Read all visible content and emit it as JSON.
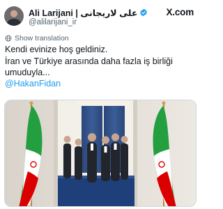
{
  "author": {
    "display_name": "Ali Larijani | علی لاریجانی",
    "handle": "@alilarijani_ir",
    "verified": true
  },
  "brand": {
    "label": "X.com"
  },
  "translation_link": {
    "label": "Show translation",
    "icon": "globe-icon"
  },
  "tweet": {
    "lines": [
      "Kendi evinize hoş geldiniz.",
      "İran ve Türkiye arasında daha fazla iş birliği",
      "umuduyla..."
    ],
    "mention": "@HakanFidan"
  },
  "media": {
    "icons": [
      "iran-flag-left",
      "iran-flag-right"
    ]
  },
  "colors": {
    "link": "#1d9bf0",
    "verified": "#1d9bf0",
    "secondary_text": "#536471",
    "curtain": "#2f4e86",
    "carpet": "#1f3f7a"
  }
}
